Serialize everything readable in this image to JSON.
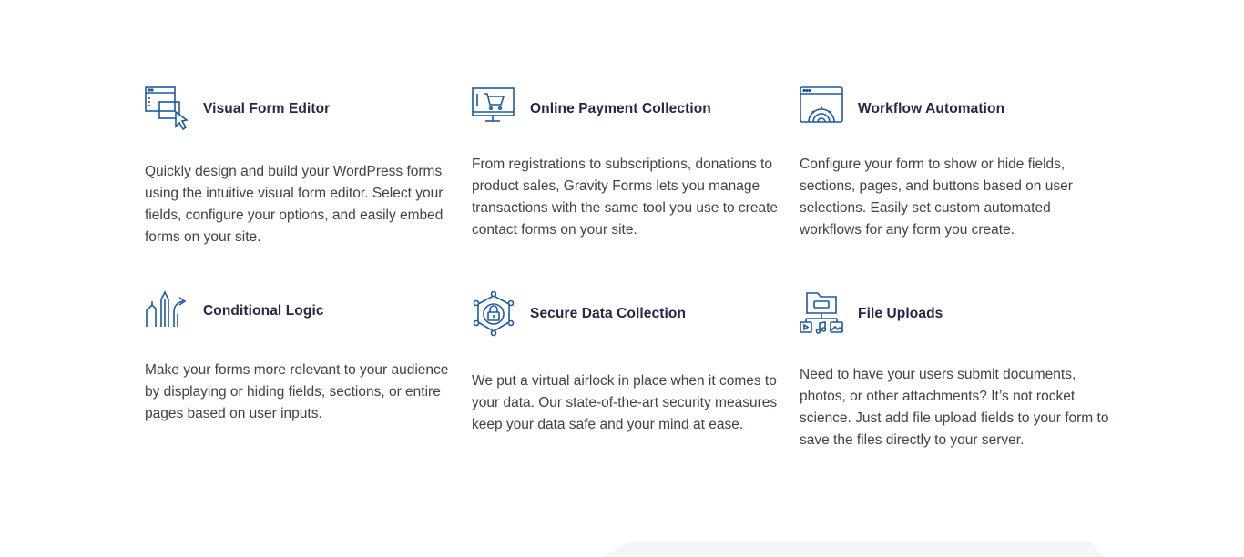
{
  "features": [
    {
      "title": "Visual Form Editor",
      "icon": "form-editor-icon",
      "description": "Quickly design and build your WordPress forms using the intuitive visual form editor. Select your fields, configure your options, and easily embed forms on your site."
    },
    {
      "title": "Online Payment Collection",
      "icon": "payment-cart-icon",
      "description": "From registrations to subscriptions, donations to product sales, Gravity Forms lets you manage transactions with the same tool you use to create contact forms on your site."
    },
    {
      "title": "Workflow Automation",
      "icon": "workflow-gear-icon",
      "description": "Configure your form to show or hide fields, sections, pages, and buttons based on user selections. Easily set custom automated workflows for any form you create."
    },
    {
      "title": "Conditional Logic",
      "icon": "conditional-logic-icon",
      "description": "Make your forms more relevant to your audience by displaying or hiding fields, sections, or entire pages based on user inputs."
    },
    {
      "title": "Secure Data Collection",
      "icon": "secure-lock-icon",
      "description": "We put a virtual airlock in place when it comes to your data. Our state-of-the-art security measures keep your data safe and your mind at ease."
    },
    {
      "title": "File Uploads",
      "icon": "file-upload-icon",
      "description": "Need to have your users submit documents, photos, or other attachments? It’s not rocket science. Just add file upload fields to your form to save the files directly to your server."
    }
  ],
  "colors": {
    "icon": "#1c5aa0",
    "title": "#242748",
    "text": "#3b4350"
  }
}
